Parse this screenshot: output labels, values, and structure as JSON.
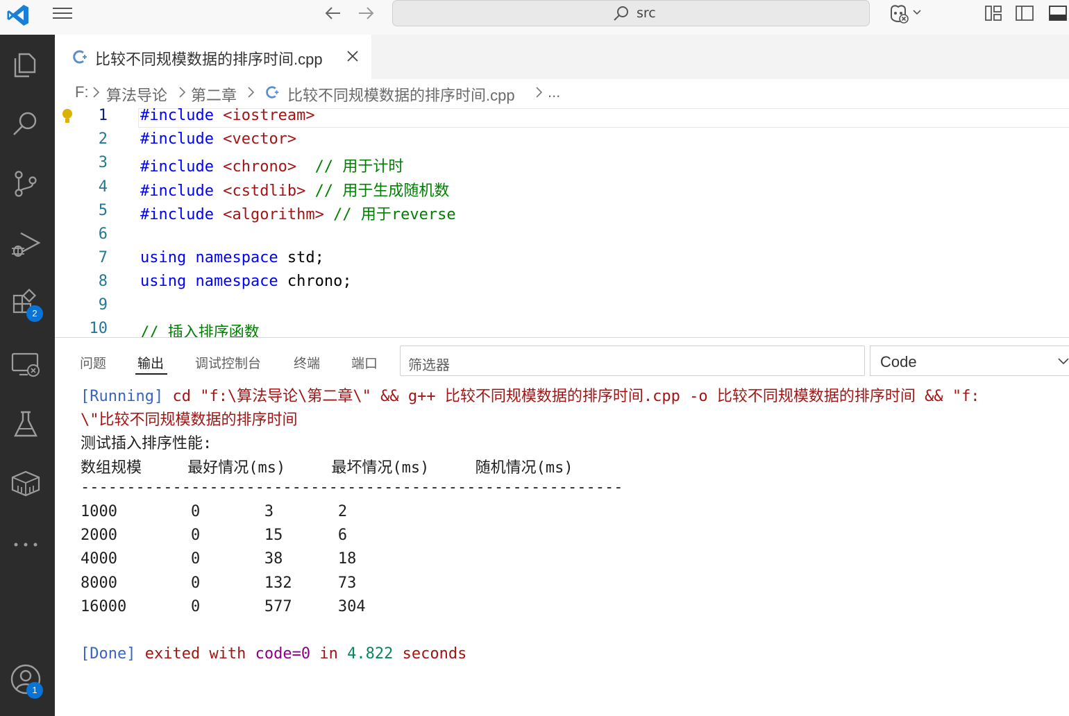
{
  "titlebar": {
    "search_text": "src"
  },
  "activity": {
    "extensions_badge": "2",
    "accounts_badge": "1"
  },
  "tab": {
    "label": "比较不同规模数据的排序时间.cpp"
  },
  "breadcrumb": {
    "items": [
      "F:",
      "算法导论",
      "第二章",
      "比较不同规模数据的排序时间.cpp",
      "..."
    ]
  },
  "editor": {
    "lines": [
      {
        "n": "1",
        "a": "#include",
        "b": " <iostream>",
        "c": ""
      },
      {
        "n": "2",
        "a": "#include",
        "b": " <vector>",
        "c": ""
      },
      {
        "n": "3",
        "a": "#include",
        "b": " <chrono>",
        "c": "  // 用于计时"
      },
      {
        "n": "4",
        "a": "#include",
        "b": " <cstdlib>",
        "c": " // 用于生成随机数"
      },
      {
        "n": "5",
        "a": "#include",
        "b": " <algorithm>",
        "c": " // 用于reverse"
      },
      {
        "n": "6",
        "a": "",
        "b": "",
        "c": ""
      },
      {
        "n": "7",
        "a": "using namespace",
        "b": " std;",
        "c": ""
      },
      {
        "n": "8",
        "a": "using namespace",
        "b": " chrono;",
        "c": ""
      },
      {
        "n": "9",
        "a": "",
        "b": "",
        "c": ""
      },
      {
        "n": "10",
        "a": "",
        "b": "",
        "c": "// 插入排序函数"
      }
    ]
  },
  "panel": {
    "tabs": [
      "问题",
      "输出",
      "调试控制台",
      "终端",
      "端口"
    ],
    "filter_placeholder": "筛选器",
    "channel": "Code",
    "running_tag": "[Running]",
    "running_cmd": " cd \"f:\\算法导论\\第二章\\\" && g++ 比较不同规模数据的排序时间.cpp -o 比较不同规模数据的排序时间 && \"f:",
    "running_cmd2": "\\\"比较不同规模数据的排序时间",
    "heading": "测试插入排序性能:",
    "table_header": "数组规模     最好情况(ms)     最坏情况(ms)     随机情况(ms)",
    "divider": "-----------------------------------------------------------",
    "rows": [
      "1000        0       3       2",
      "2000        0       15      6",
      "4000        0       38      18",
      "8000        0       132     73",
      "16000       0       577     304"
    ],
    "done_tag": "[Done]",
    "done_text1": " exited with ",
    "done_code": "code=0",
    "done_text2": " in ",
    "done_time": "4.822",
    "done_text3": " seconds"
  }
}
